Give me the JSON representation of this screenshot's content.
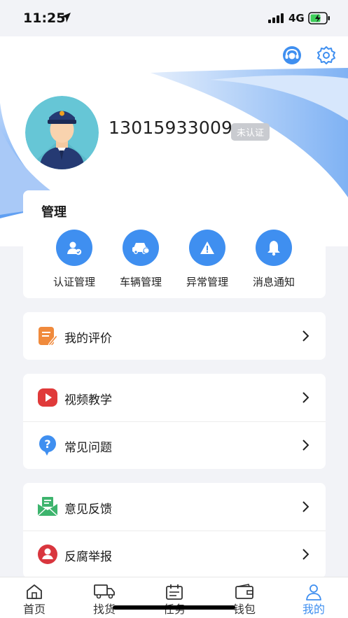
{
  "status_bar": {
    "time": "11:25",
    "network": "4G"
  },
  "profile": {
    "phone": "13015933009",
    "verification_badge": "未认证"
  },
  "management": {
    "title": "管理",
    "items": [
      {
        "label": "认证管理",
        "icon": "user-check-icon"
      },
      {
        "label": "车辆管理",
        "icon": "car-icon"
      },
      {
        "label": "异常管理",
        "icon": "warning-icon"
      },
      {
        "label": "消息通知",
        "icon": "bell-icon"
      }
    ]
  },
  "menu": {
    "review": "我的评价",
    "video_tutorial": "视频教学",
    "faq": "常见问题",
    "feedback": "意见反馈",
    "report": "反腐举报"
  },
  "tabbar": {
    "items": [
      {
        "label": "首页",
        "icon": "home-icon"
      },
      {
        "label": "找货",
        "icon": "truck-icon"
      },
      {
        "label": "任务",
        "icon": "calendar-icon"
      },
      {
        "label": "钱包",
        "icon": "wallet-icon"
      },
      {
        "label": "我的",
        "icon": "person-icon"
      }
    ],
    "active": "我的"
  },
  "colors": {
    "accent": "#3f8ff0",
    "review_icon": "#f08a3c",
    "video_icon": "#e03a3a",
    "faq_icon": "#3f8ff0",
    "feedback_icon": "#3db46d",
    "report_icon": "#d9363e"
  }
}
